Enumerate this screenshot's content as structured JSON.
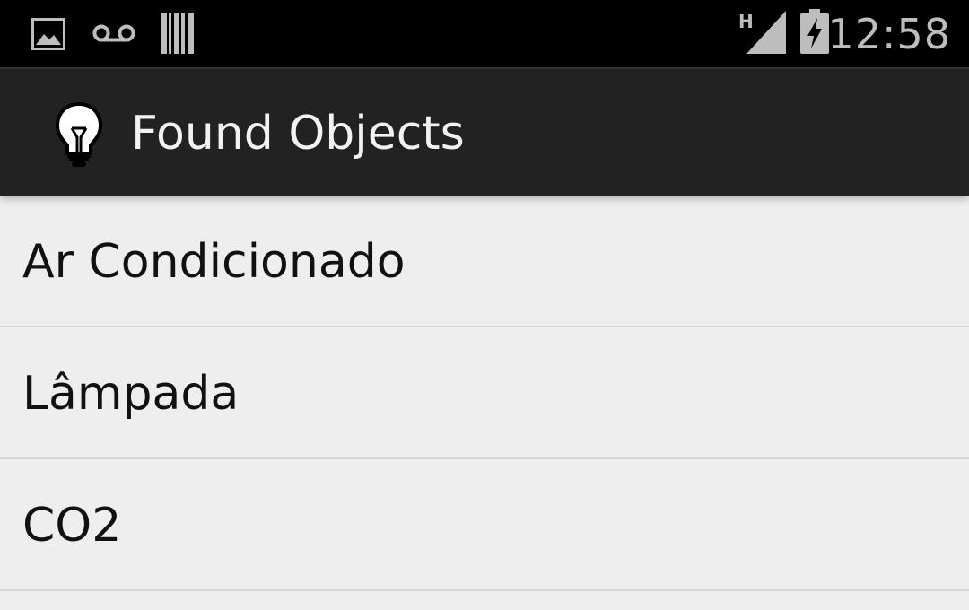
{
  "status_bar": {
    "time": "12:58",
    "network_type": "H",
    "icons": [
      "picture-icon",
      "voicemail-icon",
      "barcode-icon",
      "signal-icon",
      "battery-charging-icon"
    ]
  },
  "action_bar": {
    "title": "Found Objects",
    "app_icon": "lightbulb-icon"
  },
  "list": {
    "items": [
      {
        "label": "Ar Condicionado"
      },
      {
        "label": "Lâmpada"
      },
      {
        "label": "CO2"
      }
    ]
  },
  "colors": {
    "status_bar_bg": "#000000",
    "action_bar_bg": "#222222",
    "list_bg": "#eeeeee",
    "divider": "#d5d5d5"
  }
}
